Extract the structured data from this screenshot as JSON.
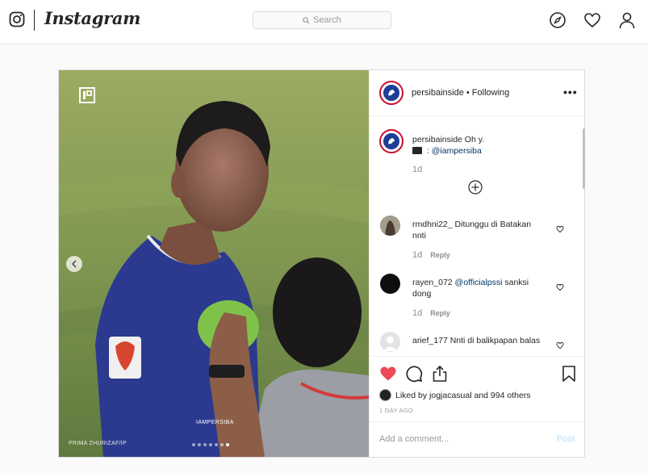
{
  "nav": {
    "wordmark": "Instagram",
    "search_placeholder": "Search",
    "icons": [
      "instagram-icon",
      "compass-icon",
      "heart-icon",
      "profile-icon"
    ]
  },
  "post": {
    "username": "persibainside",
    "follow_status": "Following",
    "header_sep": " • ",
    "more": "•••",
    "photo": {
      "credit": "PRIMA ZHURIZAF/IP",
      "watermark": "IAMPERSIBA",
      "carousel": {
        "count": 7,
        "active": 6
      }
    },
    "caption": {
      "username": "persibainside",
      "text": "Oh y.",
      "line2_prefix": " : ",
      "mention": "@iampersiba",
      "time": "1d"
    },
    "comments": [
      {
        "username": "rmdhni22_",
        "text": "Ditunggu di Batakan nnti",
        "mention": "",
        "time": "1d",
        "reply": "Reply"
      },
      {
        "username": "rayen_072",
        "mention": "@officialpssi",
        "text": "sanksi dong",
        "time": "1d",
        "reply": "Reply"
      },
      {
        "username": "arief_177",
        "text": "Nnti di balikpapan balas",
        "mention": "",
        "time": "",
        "reply": ""
      }
    ],
    "likes": {
      "prefix": "Liked by",
      "liker": "jogjacasual",
      "suffix": "and 994 others"
    },
    "date": "1 DAY AGO",
    "add_comment_placeholder": "Add a comment...",
    "post_label": "Post"
  },
  "colors": {
    "like": "#ed4956",
    "mention": "#003569",
    "club_blue": "#1c3e96",
    "club_red": "#c8102e",
    "post_disabled": "#b2dffc"
  }
}
